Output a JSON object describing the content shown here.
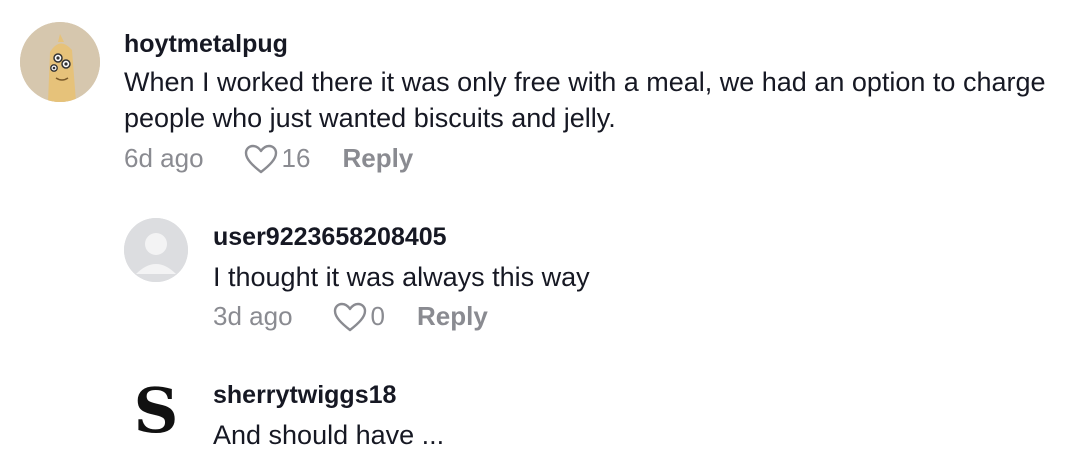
{
  "comments": [
    {
      "username": "hoytmetalpug",
      "text": "When I worked there it was only free with a meal, we had an option to charge people who just wanted biscuits and jelly.",
      "time": "6d ago",
      "likes": "16",
      "reply_label": "Reply"
    },
    {
      "username": "user9223658208405",
      "text": "I thought it was always this way",
      "time": "3d ago",
      "likes": "0",
      "reply_label": "Reply"
    },
    {
      "username": "sherrytwiggs18",
      "text": "And should have ...",
      "avatar_letter": "S"
    }
  ],
  "icons": {
    "like": "heart-outline-icon",
    "default_avatar": "default-user-avatar-icon"
  },
  "colors": {
    "text_primary": "#161823",
    "text_secondary": "#8a8b91"
  }
}
